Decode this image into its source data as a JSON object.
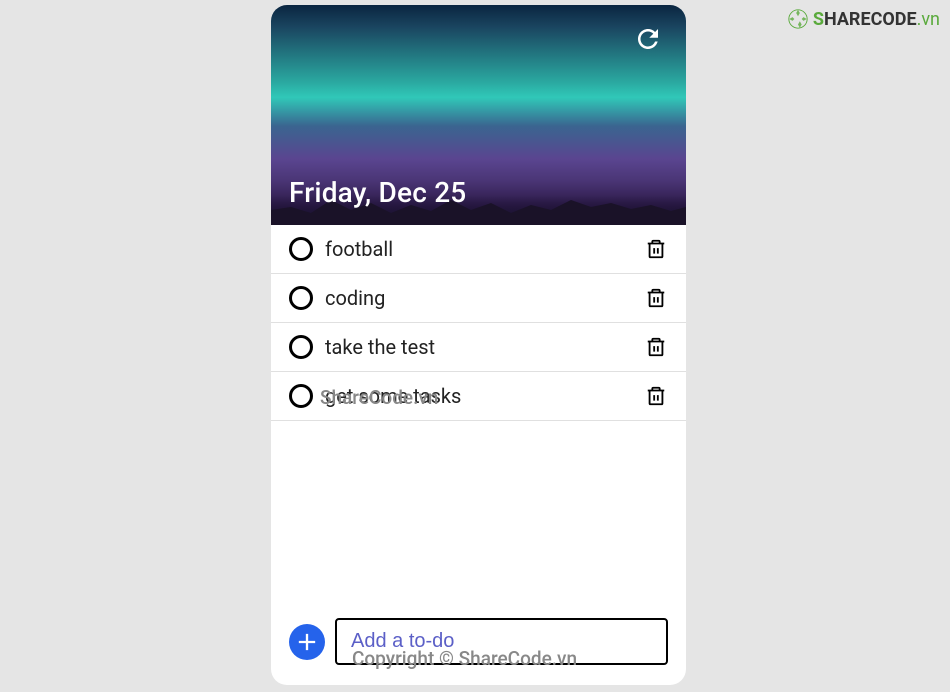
{
  "header": {
    "date": "Friday, Dec 25"
  },
  "todos": [
    {
      "text": "football"
    },
    {
      "text": "coding"
    },
    {
      "text": "take the test"
    },
    {
      "text": "get some tasks"
    }
  ],
  "input": {
    "placeholder": "Add a to-do"
  },
  "watermarks": {
    "logo_s": "S",
    "logo_rest": "HARECODE",
    "logo_ext": ".vn",
    "center": "ShareCode.vn",
    "bottom": "Copyright © ShareCode.vn"
  }
}
